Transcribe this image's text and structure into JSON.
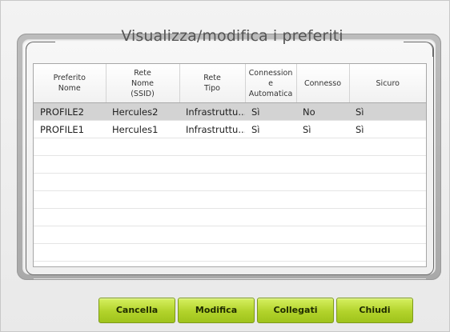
{
  "dialog": {
    "title": "Visualizza/modifica i preferiti"
  },
  "table": {
    "columns": [
      "Preferito\nNome",
      "Rete\nNome\n(SSID)",
      "Rete\nTipo",
      "Connession\ne\nAutomatica",
      "Connesso",
      "Sicuro"
    ],
    "rows": [
      [
        "PROFILE2",
        "Hercules2",
        "Infrastruttu...",
        "Sì",
        "No",
        "Sì"
      ],
      [
        "PROFILE1",
        "Hercules1",
        "Infrastruttu...",
        "Sì",
        "Sì",
        "Sì"
      ]
    ],
    "selected_row": 0
  },
  "buttons": {
    "delete": "Cancella",
    "edit": "Modifica",
    "connect": "Collegati",
    "close": "Chiudi"
  },
  "colors": {
    "button_green": "#b2d32b",
    "selected_row": "#d3d3d3"
  }
}
